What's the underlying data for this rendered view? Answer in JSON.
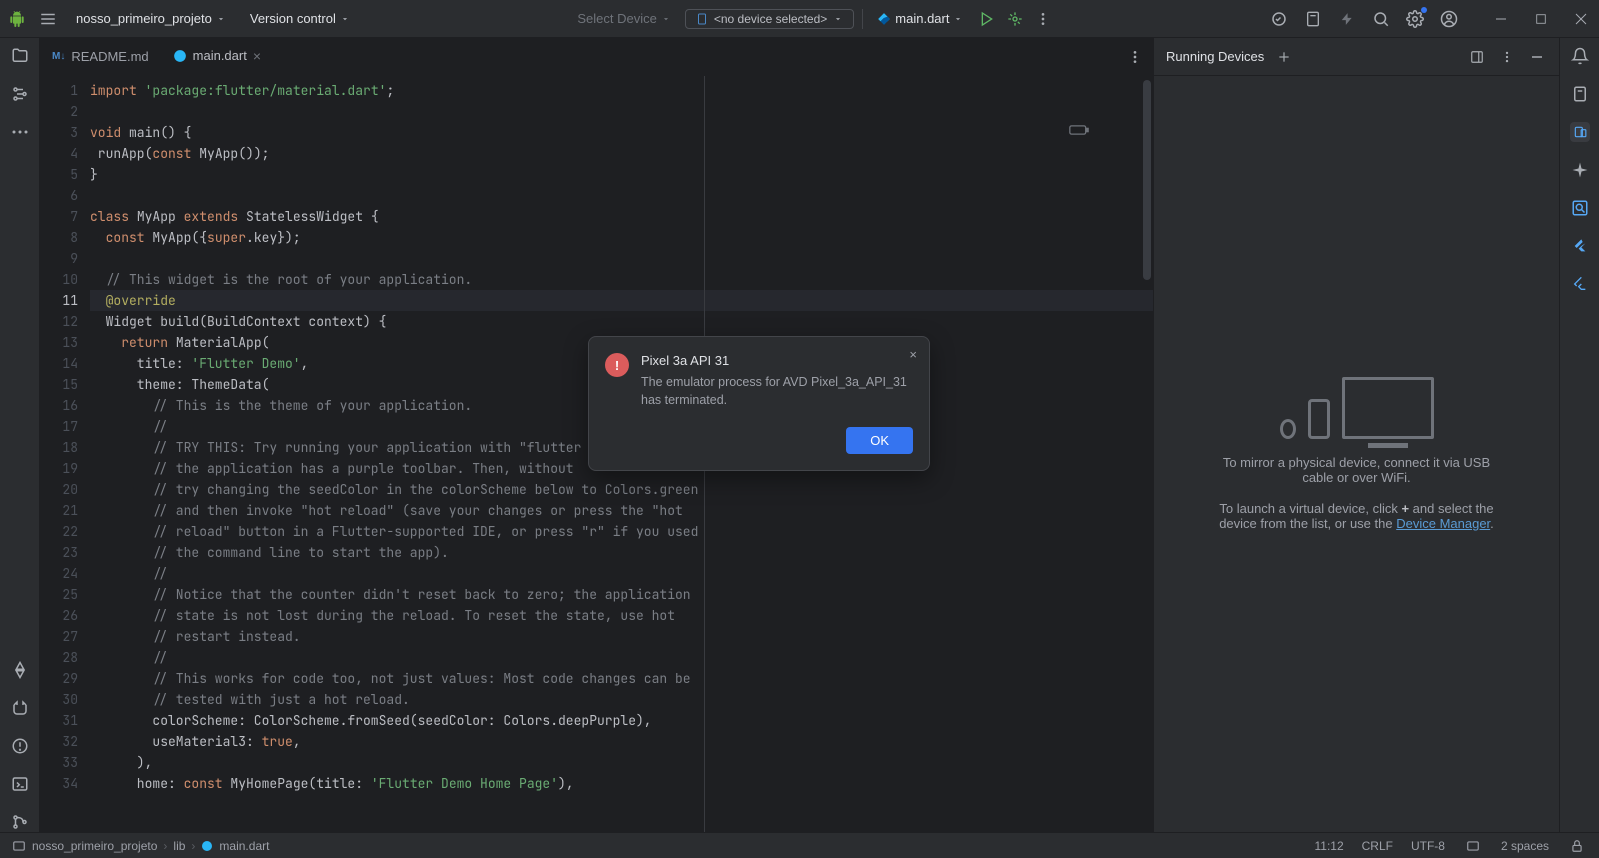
{
  "titlebar": {
    "project": "nosso_primeiro_projeto",
    "vcs": "Version control",
    "select_device": "Select Device",
    "no_device": "<no device selected>",
    "config": "main.dart"
  },
  "tabs": {
    "readme": "README.md",
    "main": "main.dart"
  },
  "gutter": {
    "start": 1,
    "end": 34,
    "highlight": 11
  },
  "code_lines": [
    {
      "t": [
        [
          "kw",
          "import"
        ],
        [
          "",
          " "
        ],
        [
          "str",
          "'package:flutter/material.dart'"
        ],
        [
          "",
          ";"
        ]
      ]
    },
    {
      "t": [
        [
          "",
          ""
        ]
      ]
    },
    {
      "t": [
        [
          "kw",
          "void"
        ],
        [
          "",
          " main() {"
        ]
      ]
    },
    {
      "t": [
        [
          "",
          " runApp("
        ],
        [
          "kw",
          "const"
        ],
        [
          "",
          " MyApp());"
        ]
      ]
    },
    {
      "t": [
        [
          "",
          "}"
        ]
      ]
    },
    {
      "t": [
        [
          "",
          ""
        ]
      ]
    },
    {
      "t": [
        [
          "kw",
          "class"
        ],
        [
          "",
          " MyApp "
        ],
        [
          "kw",
          "extends"
        ],
        [
          "",
          " StatelessWidget {"
        ]
      ]
    },
    {
      "t": [
        [
          "",
          "  "
        ],
        [
          "kw",
          "const"
        ],
        [
          "",
          " MyApp({"
        ],
        [
          "kw",
          "super"
        ],
        [
          "",
          ".key});"
        ]
      ]
    },
    {
      "t": [
        [
          "",
          ""
        ]
      ]
    },
    {
      "t": [
        [
          "",
          "  "
        ],
        [
          "cmt",
          "// This widget is the root of your application."
        ]
      ]
    },
    {
      "t": [
        [
          "",
          "  "
        ],
        [
          "anno",
          "@override"
        ]
      ]
    },
    {
      "t": [
        [
          "",
          "  Widget build(BuildContext context) {"
        ]
      ]
    },
    {
      "t": [
        [
          "",
          "    "
        ],
        [
          "kw",
          "return"
        ],
        [
          "",
          " MaterialApp("
        ]
      ]
    },
    {
      "t": [
        [
          "",
          "      title: "
        ],
        [
          "str",
          "'Flutter Demo'"
        ],
        [
          "",
          ","
        ]
      ]
    },
    {
      "t": [
        [
          "",
          "      theme: ThemeData("
        ]
      ]
    },
    {
      "t": [
        [
          "",
          "        "
        ],
        [
          "cmt",
          "// This is the theme of your application."
        ]
      ]
    },
    {
      "t": [
        [
          "",
          "        "
        ],
        [
          "cmt",
          "//"
        ]
      ]
    },
    {
      "t": [
        [
          "",
          "        "
        ],
        [
          "cmt",
          "// TRY THIS: Try running your application with \"flutter"
        ]
      ]
    },
    {
      "t": [
        [
          "",
          "        "
        ],
        [
          "cmt",
          "// the application has a purple toolbar. Then, without"
        ]
      ]
    },
    {
      "t": [
        [
          "",
          "        "
        ],
        [
          "cmt",
          "// try changing the seedColor in the colorScheme below to Colors.green"
        ]
      ]
    },
    {
      "t": [
        [
          "",
          "        "
        ],
        [
          "cmt",
          "// and then invoke \"hot reload\" (save your changes or press the \"hot"
        ]
      ]
    },
    {
      "t": [
        [
          "",
          "        "
        ],
        [
          "cmt",
          "// reload\" button in a Flutter-supported IDE, or press \"r\" if you used"
        ]
      ]
    },
    {
      "t": [
        [
          "",
          "        "
        ],
        [
          "cmt",
          "// the command line to start the app)."
        ]
      ]
    },
    {
      "t": [
        [
          "",
          "        "
        ],
        [
          "cmt",
          "//"
        ]
      ]
    },
    {
      "t": [
        [
          "",
          "        "
        ],
        [
          "cmt",
          "// Notice that the counter didn't reset back to zero; the application"
        ]
      ]
    },
    {
      "t": [
        [
          "",
          "        "
        ],
        [
          "cmt",
          "// state is not lost during the reload. To reset the state, use hot"
        ]
      ]
    },
    {
      "t": [
        [
          "",
          "        "
        ],
        [
          "cmt",
          "// restart instead."
        ]
      ]
    },
    {
      "t": [
        [
          "",
          "        "
        ],
        [
          "cmt",
          "//"
        ]
      ]
    },
    {
      "t": [
        [
          "",
          "        "
        ],
        [
          "cmt",
          "// This works for code too, not just values: Most code changes can be"
        ]
      ]
    },
    {
      "t": [
        [
          "",
          "        "
        ],
        [
          "cmt",
          "// tested with just a hot reload."
        ]
      ]
    },
    {
      "t": [
        [
          "",
          "        colorScheme: ColorScheme.fromSeed(seedColor: Colors.deepPurple),"
        ]
      ]
    },
    {
      "t": [
        [
          "",
          "        useMaterial3: "
        ],
        [
          "kw",
          "true"
        ],
        [
          "",
          ","
        ]
      ]
    },
    {
      "t": [
        [
          "",
          "      ),"
        ]
      ]
    },
    {
      "t": [
        [
          "",
          "      home: "
        ],
        [
          "kw",
          "const"
        ],
        [
          "",
          " MyHomePage(title: "
        ],
        [
          "str",
          "'Flutter Demo Home Page'"
        ],
        [
          "",
          "),"
        ]
      ]
    }
  ],
  "right_panel": {
    "title": "Running Devices",
    "msg1": "To mirror a physical device, connect it via USB cable or over WiFi.",
    "msg2a": "To launch a virtual device, click ",
    "msg2b": " and select the device from the list, or use the ",
    "link": "Device Manager",
    "msg2c": "."
  },
  "dialog": {
    "title": "Pixel 3a API 31",
    "msg": "The emulator process for AVD Pixel_3a_API_31 has terminated.",
    "ok": "OK"
  },
  "breadcrumb": {
    "p1": "nosso_primeiro_projeto",
    "p2": "lib",
    "p3": "main.dart"
  },
  "status": {
    "pos": "11:12",
    "eol": "CRLF",
    "enc": "UTF-8",
    "indent": "2 spaces"
  }
}
